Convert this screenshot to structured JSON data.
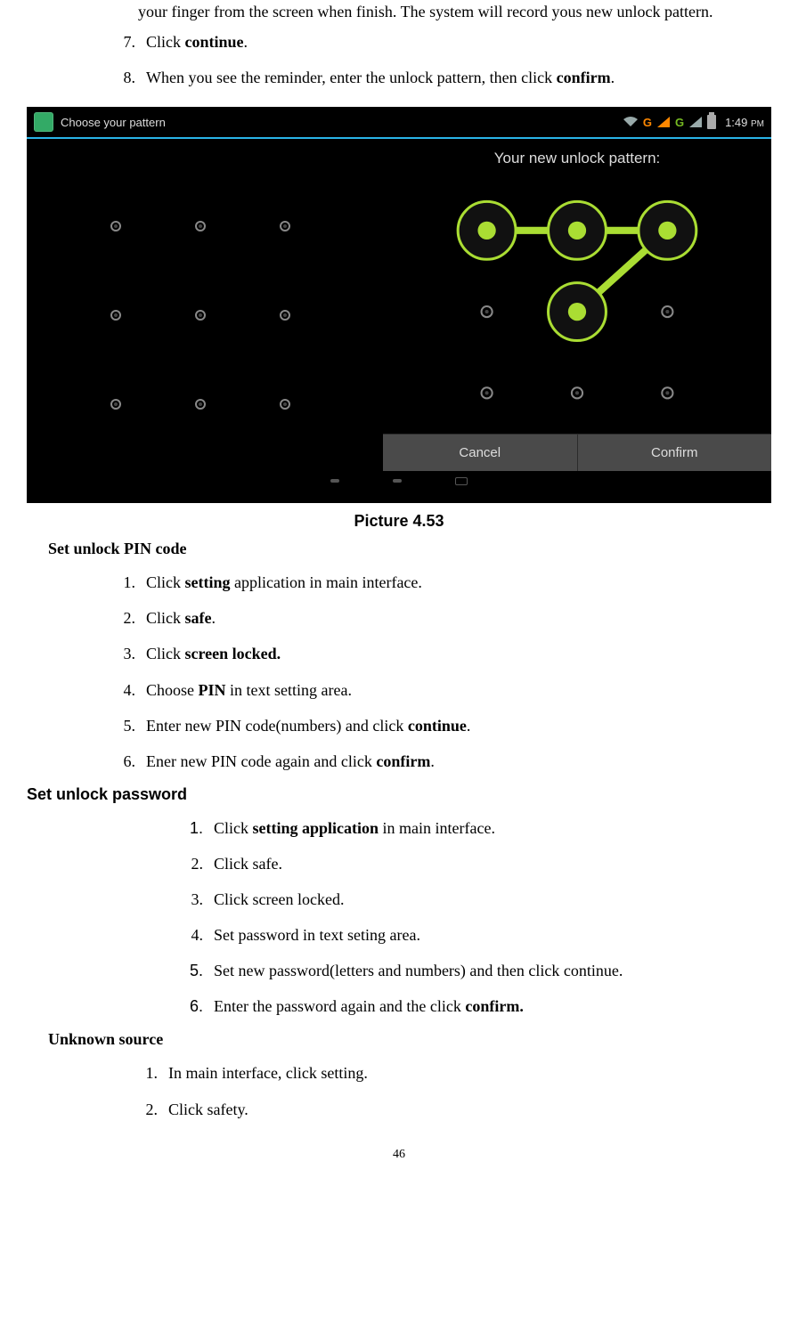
{
  "paragraph_continued": "your finger from the screen when finish. The system will record yous new unlock pattern.",
  "listA": {
    "i7p": "Click ",
    "i7b": "continue",
    "i7s": ".",
    "i8p": "When you see the reminder, enter the unlock pattern, then click ",
    "i8b": "confirm",
    "i8s": "."
  },
  "screenshot": {
    "status_title": "Choose your pattern",
    "g1": "G",
    "g2": "G",
    "time": "1:49",
    "ampm": "PM",
    "panel_title": "Your new unlock pattern:",
    "btn_cancel": "Cancel",
    "btn_confirm": "Confirm"
  },
  "caption": "Picture 4.53",
  "headB": "Set unlock PIN code",
  "listB": {
    "l1a": "Click ",
    "l1b": "setting",
    "l1c": " application in main interface.",
    "l2a": "Click ",
    "l2b": "safe",
    "l2c": ".",
    "l3a": "Click ",
    "l3b": "screen locked.",
    "l4a": "Choose ",
    "l4b": "PIN",
    "l4c": " in text setting area.",
    "l5a": "Enter new PIN code(numbers) and click ",
    "l5b": "continue",
    "l5c": ".",
    "l6a": "Ener new PIN code again and click ",
    "l6b": "confirm",
    "l6c": "."
  },
  "headC": "Set unlock password",
  "listC": {
    "l1a": "Click ",
    "l1b": "setting application",
    "l1c": " in main interface.",
    "l2": "Click safe.",
    "l3": "Click screen locked.",
    "l4": "Set password in text seting area.",
    "l5": "Set new password(letters and numbers) and then click continue.",
    "l6a": "Enter the password again and the click ",
    "l6b": "confirm."
  },
  "headD": "Unknown source",
  "listD": {
    "l1": "In main interface, click setting.",
    "l2": "Click safety."
  },
  "pagenum": "46",
  "nums": {
    "n1": "1.",
    "n2": "2.",
    "n3": "3.",
    "n4": "4.",
    "n5": "5.",
    "n6": "6.",
    "n7": "7.",
    "n8": "8."
  }
}
